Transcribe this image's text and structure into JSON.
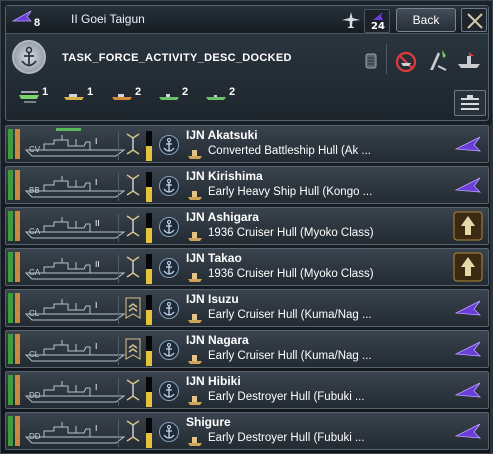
{
  "header": {
    "flag_count": "8",
    "title": "II Goei Taigun",
    "carrier_count": "24",
    "back_label": "Back",
    "description": "TASK_FORCE_ACTIVITY_DESC_DOCKED"
  },
  "composition": [
    {
      "class": "CV",
      "count": "1"
    },
    {
      "class": "BC",
      "count": "1"
    },
    {
      "class": "CA",
      "count": "2"
    },
    {
      "class": "CL",
      "count": "2"
    },
    {
      "class": "DD",
      "count": "2"
    }
  ],
  "ships": [
    {
      "name": "IJN Akatsuki",
      "hull": "Converted Battleship Hull (Ak ...",
      "class": "CV",
      "rank": "I"
    },
    {
      "name": "IJN Kirishima",
      "hull": "Early Heavy Ship Hull (Kongo ...",
      "class": "BB",
      "rank": "I"
    },
    {
      "name": "IJN Ashigara",
      "hull": "1936 Cruiser Hull (Myoko Class)",
      "class": "CA",
      "rank": "II"
    },
    {
      "name": "IJN Takao",
      "hull": "1936 Cruiser Hull (Myoko Class)",
      "class": "CA",
      "rank": "II"
    },
    {
      "name": "IJN Isuzu",
      "hull": "Early Cruiser Hull (Kuma/Nag ...",
      "class": "CL",
      "rank": "I"
    },
    {
      "name": "IJN Nagara",
      "hull": "Early Cruiser Hull (Kuma/Nag ...",
      "class": "CL",
      "rank": "I"
    },
    {
      "name": "IJN Hibiki",
      "hull": "Early Destroyer Hull (Fubuki ...",
      "class": "DD",
      "rank": "I"
    },
    {
      "name": "Shigure",
      "hull": "Early Destroyer Hull (Fubuki ...",
      "class": "DD",
      "rank": "I"
    }
  ],
  "colors": {
    "accent_purple": "#6a3dd8",
    "strength_green": "#3f9c3a",
    "organization_orange": "#c98a3f",
    "experience_yellow": "#e4c23a"
  }
}
